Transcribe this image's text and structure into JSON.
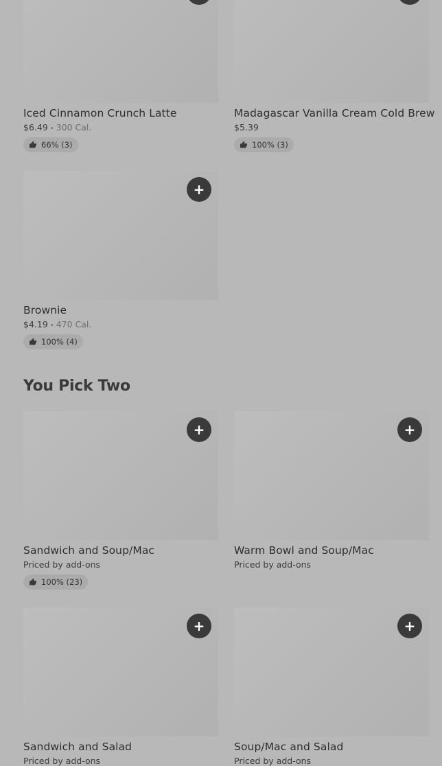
{
  "items": {
    "iced_latte": {
      "name": "Iced Cinnamon Crunch Latte",
      "price": "$6.49",
      "sep": "•",
      "calories": "300 Cal.",
      "rating": "66% (3)"
    },
    "vanilla_cold_brew": {
      "name": "Madagascar Vanilla Cream Cold Brew",
      "price": "$5.39",
      "rating": "100% (3)"
    },
    "brownie": {
      "name": "Brownie",
      "price": "$4.19",
      "sep": "•",
      "calories": "470 Cal.",
      "rating": "100% (4)"
    }
  },
  "you_pick_two": {
    "title": "You Pick Two",
    "items": {
      "sandwich_soup": {
        "name": "Sandwich and Soup/Mac",
        "price": "Priced by add-ons",
        "rating": "100% (23)"
      },
      "warm_bowl_soup": {
        "name": "Warm Bowl and Soup/Mac",
        "price": "Priced by add-ons"
      },
      "sandwich_salad": {
        "name": "Sandwich and Salad",
        "price": "Priced by add-ons"
      },
      "soup_salad": {
        "name": "Soup/Mac and Salad",
        "price": "Priced by add-ons"
      }
    }
  },
  "add_button_glyph": "+",
  "icons": {
    "add": "plus-icon",
    "rating": "thumbs-up-icon"
  },
  "colors": {
    "background": "#b8b8b8",
    "add_button": "#3a3a3a",
    "rating_pill": "#ababab"
  }
}
